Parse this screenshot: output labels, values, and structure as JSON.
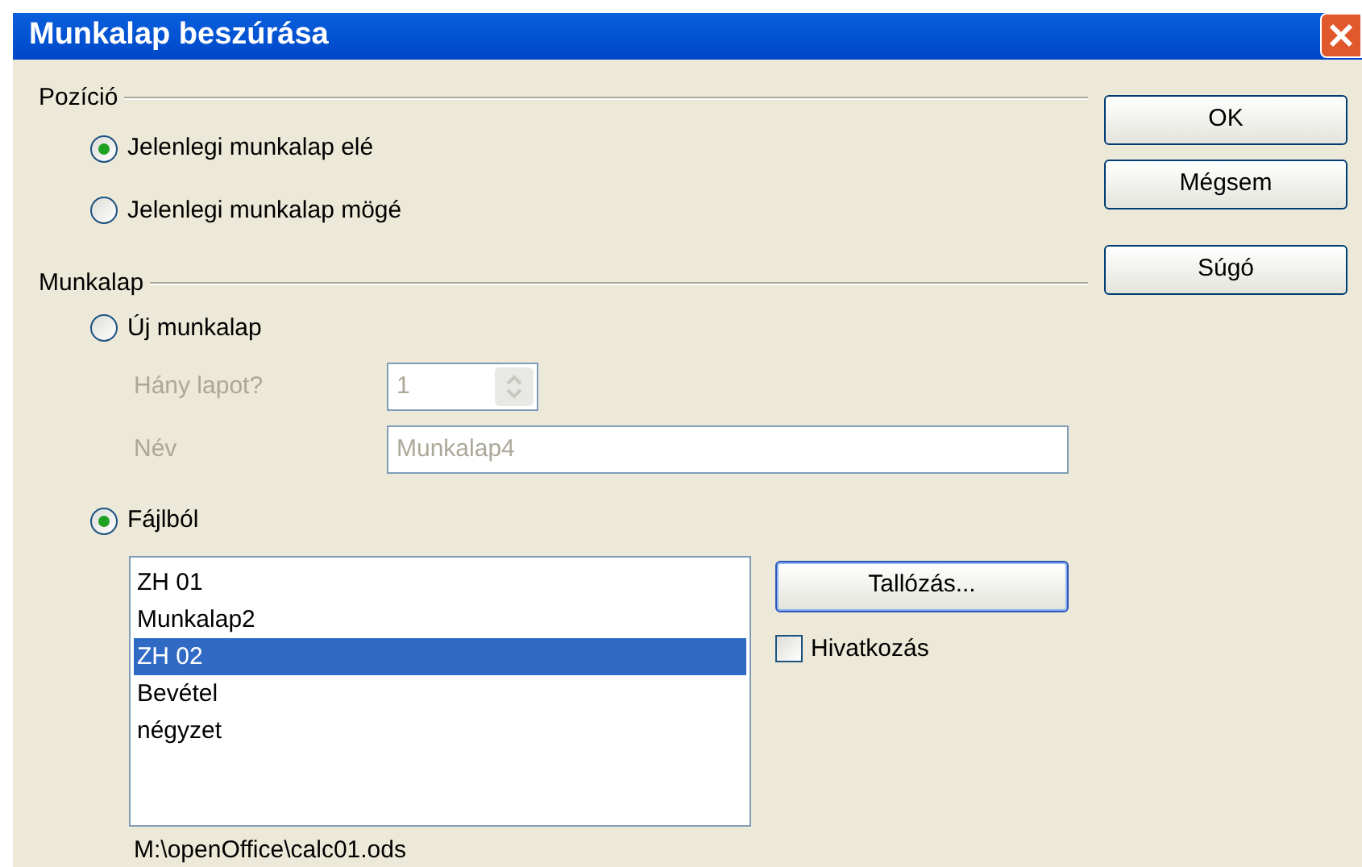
{
  "window": {
    "title": "Munkalap beszúrása"
  },
  "position": {
    "label": "Pozíció",
    "options": [
      {
        "label": "Jelenlegi munkalap elé",
        "selected": true
      },
      {
        "label": "Jelenlegi munkalap mögé",
        "selected": false
      }
    ]
  },
  "sheet": {
    "label": "Munkalap",
    "new_sheet": {
      "label": "Új munkalap",
      "selected": false,
      "count_label": "Hány lapot?",
      "count_value": "1",
      "name_label": "Név",
      "name_value": "Munkalap4",
      "disabled": true
    },
    "from_file": {
      "label": "Fájlból",
      "selected": true,
      "files": [
        {
          "label": "ZH 01",
          "selected": false
        },
        {
          "label": "Munkalap2",
          "selected": false
        },
        {
          "label": "ZH 02",
          "selected": true
        },
        {
          "label": "Bevétel",
          "selected": false
        },
        {
          "label": "négyzet",
          "selected": false
        }
      ],
      "browse_button": "Tallózás...",
      "link": {
        "label": "Hivatkozás",
        "checked": false
      },
      "path": "M:\\openOffice\\calc01.ods"
    }
  },
  "buttons": [
    "OK",
    "Mégsem",
    "Súgó"
  ]
}
